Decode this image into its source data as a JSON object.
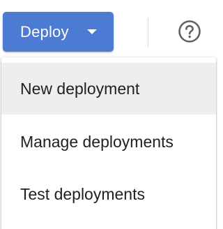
{
  "toolbar": {
    "deploy_label": "Deploy",
    "deploy_caret_icon": "caret-down-icon",
    "help_icon": "help-circle-icon"
  },
  "deploy_menu": {
    "items": [
      {
        "label": "New deployment",
        "highlighted": true
      },
      {
        "label": "Manage deployments",
        "highlighted": false
      },
      {
        "label": "Test deployments",
        "highlighted": false
      }
    ]
  },
  "colors": {
    "accent": "#4d7bd4",
    "hover_background": "#eeeeee",
    "text": "#202124",
    "icon": "#5f6368"
  }
}
